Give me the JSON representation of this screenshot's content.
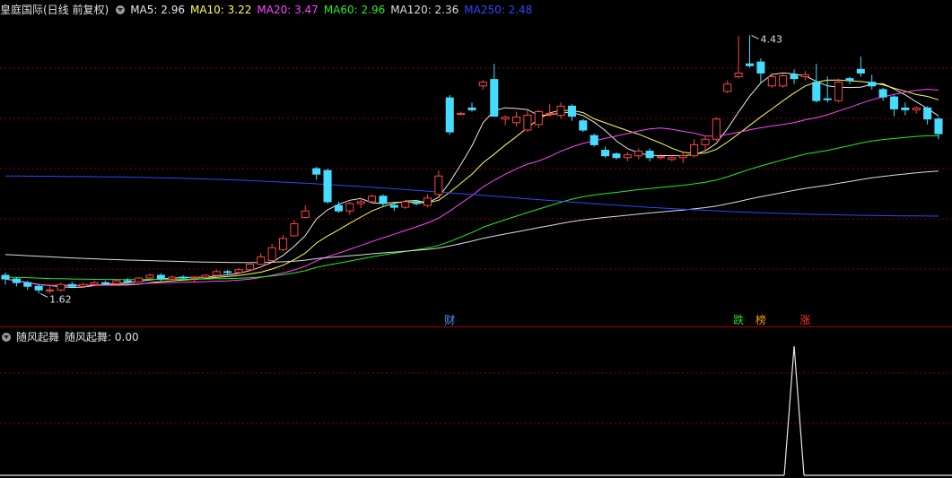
{
  "header": {
    "title": "皇庭国际(日线 前复权)",
    "ma": [
      {
        "label": "MA5: 2.96",
        "color": "#e8e8e8"
      },
      {
        "label": "MA10: 3.22",
        "color": "#ffff55"
      },
      {
        "label": "MA20: 3.47",
        "color": "#ff44ff"
      },
      {
        "label": "MA60: 2.96",
        "color": "#22ee22"
      },
      {
        "label": "MA120: 2.36",
        "color": "#dddddd"
      },
      {
        "label": "MA250: 2.48",
        "color": "#3344ff"
      }
    ]
  },
  "indicator": {
    "title": "随风起舞",
    "value_label": "随风起舞: 0.00"
  },
  "event_tags": [
    {
      "text": "财",
      "color": "#4499ff",
      "bar": 40
    },
    {
      "text": "跌",
      "color": "#22dd22",
      "bar": 66
    },
    {
      "text": "榜",
      "color": "#ff9900",
      "bar": 68
    },
    {
      "text": "涨",
      "color": "#ff3333",
      "bar": 72
    }
  ],
  "annotations": {
    "high": "4.43",
    "low": "1.62"
  },
  "colors": {
    "up": "#ff4444",
    "down": "#44ddff",
    "grid": "#880000",
    "separator": "#aa0000"
  },
  "chart_data": {
    "type": "candlestick",
    "price_range": [
      1.4,
      4.6
    ],
    "low_marker": 1.62,
    "high_marker": 4.43,
    "candles": [
      [
        1.82,
        1.78,
        1.85,
        1.72
      ],
      [
        1.78,
        1.74,
        1.8,
        1.7
      ],
      [
        1.74,
        1.7,
        1.76,
        1.66
      ],
      [
        1.7,
        1.66,
        1.72,
        1.62
      ],
      [
        1.66,
        1.66,
        1.7,
        1.62
      ],
      [
        1.66,
        1.72,
        1.74,
        1.64
      ],
      [
        1.72,
        1.7,
        1.75,
        1.68
      ],
      [
        1.7,
        1.72,
        1.74,
        1.68
      ],
      [
        1.72,
        1.74,
        1.76,
        1.7
      ],
      [
        1.74,
        1.73,
        1.76,
        1.71
      ],
      [
        1.73,
        1.76,
        1.78,
        1.72
      ],
      [
        1.76,
        1.75,
        1.79,
        1.73
      ],
      [
        1.75,
        1.79,
        1.8,
        1.74
      ],
      [
        1.79,
        1.82,
        1.84,
        1.78
      ],
      [
        1.82,
        1.78,
        1.84,
        1.76
      ],
      [
        1.78,
        1.8,
        1.82,
        1.77
      ],
      [
        1.8,
        1.79,
        1.82,
        1.78
      ],
      [
        1.79,
        1.8,
        1.81,
        1.75
      ],
      [
        1.8,
        1.82,
        1.83,
        1.79
      ],
      [
        1.82,
        1.86,
        1.88,
        1.81
      ],
      [
        1.86,
        1.85,
        1.88,
        1.83
      ],
      [
        1.85,
        1.88,
        1.9,
        1.84
      ],
      [
        1.88,
        1.94,
        1.96,
        1.87
      ],
      [
        1.94,
        2.02,
        2.06,
        1.93
      ],
      [
        1.98,
        2.12,
        2.16,
        1.97
      ],
      [
        2.1,
        2.22,
        2.26,
        2.08
      ],
      [
        2.25,
        2.38,
        2.42,
        2.24
      ],
      [
        2.45,
        2.52,
        2.58,
        2.44
      ],
      [
        2.98,
        2.92,
        3.0,
        2.86
      ],
      [
        2.96,
        2.62,
        2.98,
        2.6
      ],
      [
        2.58,
        2.52,
        2.62,
        2.5
      ],
      [
        2.52,
        2.6,
        2.62,
        2.48
      ],
      [
        2.6,
        2.62,
        2.66,
        2.55
      ],
      [
        2.62,
        2.68,
        2.7,
        2.6
      ],
      [
        2.68,
        2.6,
        2.7,
        2.56
      ],
      [
        2.58,
        2.56,
        2.62,
        2.52
      ],
      [
        2.56,
        2.62,
        2.64,
        2.54
      ],
      [
        2.62,
        2.6,
        2.64,
        2.58
      ],
      [
        2.58,
        2.66,
        2.7,
        2.56
      ],
      [
        2.7,
        2.9,
        2.96,
        2.68
      ],
      [
        3.75,
        3.38,
        3.78,
        3.35
      ],
      [
        3.58,
        3.58,
        3.6,
        3.56
      ],
      [
        3.64,
        3.62,
        3.7,
        3.6
      ],
      [
        3.88,
        3.92,
        3.94,
        3.84
      ],
      [
        3.95,
        3.55,
        4.12,
        3.55
      ],
      [
        3.52,
        3.54,
        3.56,
        3.45
      ],
      [
        3.48,
        3.54,
        3.6,
        3.44
      ],
      [
        3.4,
        3.56,
        3.62,
        3.38
      ],
      [
        3.46,
        3.6,
        3.62,
        3.42
      ],
      [
        3.58,
        3.58,
        3.68,
        3.55
      ],
      [
        3.56,
        3.66,
        3.7,
        3.52
      ],
      [
        3.66,
        3.55,
        3.68,
        3.5
      ],
      [
        3.5,
        3.4,
        3.52,
        3.38
      ],
      [
        3.34,
        3.24,
        3.36,
        3.22
      ],
      [
        3.18,
        3.12,
        3.22,
        3.1
      ],
      [
        3.14,
        3.1,
        3.16,
        3.08
      ],
      [
        3.1,
        3.13,
        3.16,
        3.06
      ],
      [
        3.12,
        3.17,
        3.2,
        3.08
      ],
      [
        3.17,
        3.1,
        3.2,
        3.06
      ],
      [
        3.1,
        3.11,
        3.14,
        3.08
      ],
      [
        3.08,
        3.1,
        3.13,
        3.06
      ],
      [
        3.1,
        3.12,
        3.16,
        3.04
      ],
      [
        3.12,
        3.24,
        3.3,
        3.1
      ],
      [
        3.24,
        3.3,
        3.34,
        3.18
      ],
      [
        3.3,
        3.52,
        3.54,
        3.28
      ],
      [
        3.82,
        3.9,
        3.94,
        3.8
      ],
      [
        3.98,
        4.02,
        4.42,
        3.96
      ],
      [
        4.12,
        4.1,
        4.43,
        4.08
      ],
      [
        4.14,
        4.02,
        4.18,
        3.92
      ],
      [
        3.88,
        3.98,
        4.02,
        3.86
      ],
      [
        3.88,
        3.99,
        4.02,
        3.86
      ],
      [
        4.0,
        3.96,
        4.06,
        3.9
      ],
      [
        3.98,
        4.0,
        4.04,
        3.94
      ],
      [
        3.92,
        3.72,
        4.12,
        3.7
      ],
      [
        3.74,
        3.73,
        3.98,
        3.7
      ],
      [
        3.72,
        3.92,
        3.96,
        3.7
      ],
      [
        3.96,
        3.94,
        3.98,
        3.9
      ],
      [
        4.06,
        4.02,
        4.2,
        3.98
      ],
      [
        3.92,
        3.88,
        4.0,
        3.84
      ],
      [
        3.84,
        3.76,
        3.86,
        3.72
      ],
      [
        3.76,
        3.63,
        3.78,
        3.55
      ],
      [
        3.64,
        3.62,
        3.7,
        3.56
      ],
      [
        3.62,
        3.64,
        3.66,
        3.58
      ],
      [
        3.64,
        3.52,
        3.66,
        3.46
      ],
      [
        3.52,
        3.36,
        3.54,
        3.3
      ]
    ],
    "indicator_series": {
      "name": "随风起舞",
      "peak_bar": 71,
      "peak_value": 1
    }
  }
}
